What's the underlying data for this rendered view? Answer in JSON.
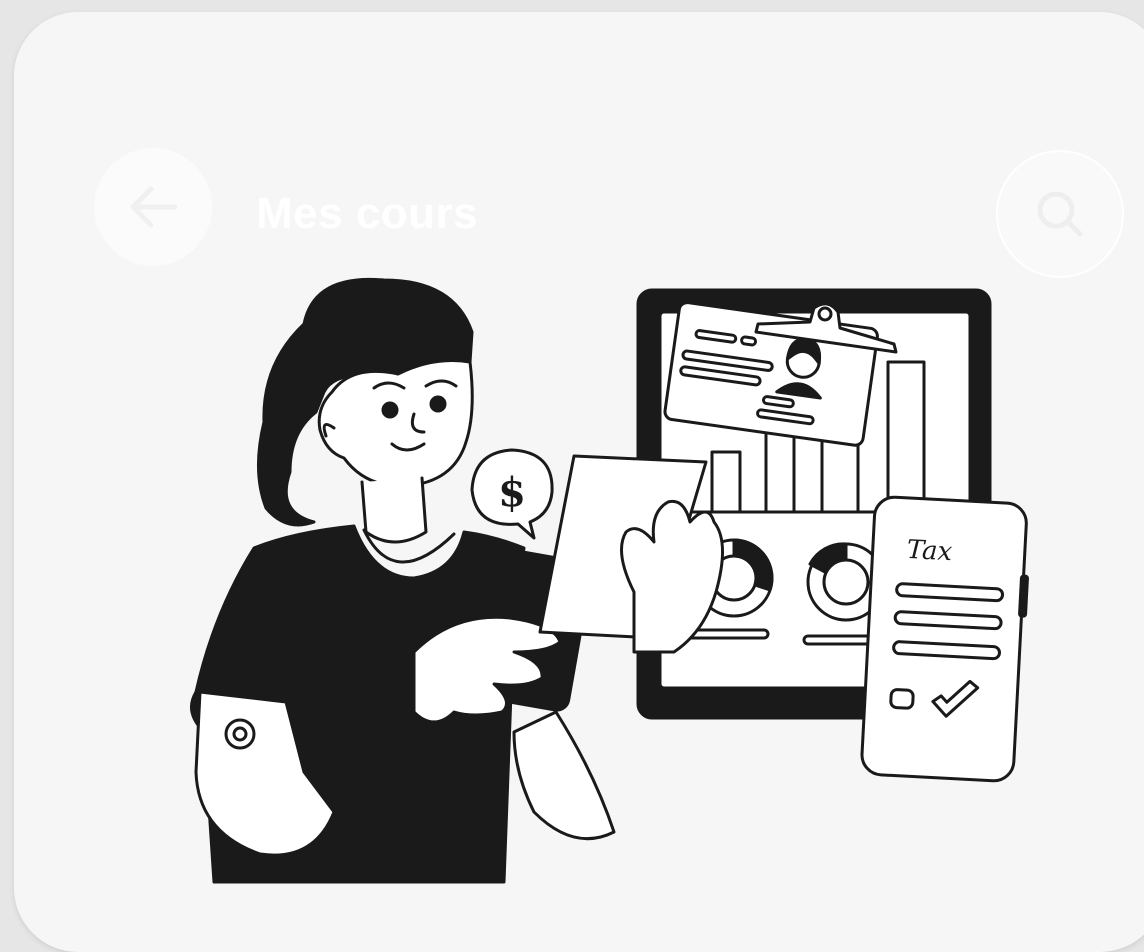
{
  "header": {
    "title": "Mes cours",
    "back_icon": "arrow-left-icon",
    "search_icon": "search-icon"
  },
  "illustration": {
    "bubble_symbol": "$",
    "phone_label": "Tax"
  },
  "colors": {
    "background": "#f6f6f6",
    "ink": "#1a1a1a",
    "header_text": "#ffffff"
  }
}
